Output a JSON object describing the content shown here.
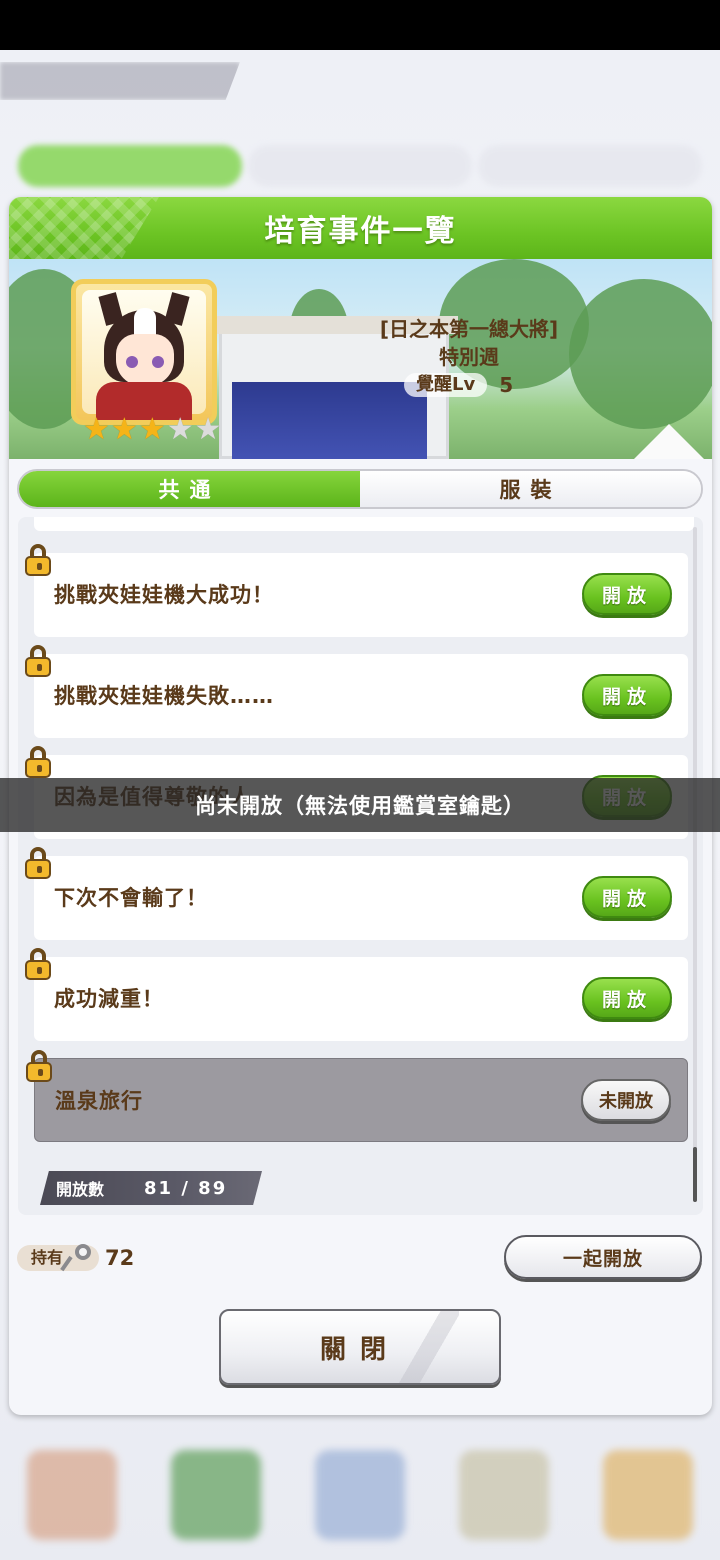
{
  "dialog": {
    "title": "培育事件一覽"
  },
  "character": {
    "scenario_line1": "[日之本第一總大將]",
    "scenario_line2": "特別週",
    "awaken_label": "覺醒Lv",
    "awaken_level": "5",
    "stars": {
      "filled": 3,
      "total": 5
    }
  },
  "tabs": [
    {
      "label": "共通",
      "active": true
    },
    {
      "label": "服裝",
      "active": false
    }
  ],
  "events": [
    {
      "label": "挑戰夾娃娃機大成功！",
      "button": "開放",
      "status": "open"
    },
    {
      "label": "挑戰夾娃娃機失敗……",
      "button": "開放",
      "status": "open"
    },
    {
      "label": "因為是值得尊敬的人",
      "button": "開放",
      "status": "open"
    },
    {
      "label": "下次不會輸了！",
      "button": "開放",
      "status": "open"
    },
    {
      "label": "成功減重！",
      "button": "開放",
      "status": "open"
    },
    {
      "label": "溫泉旅行",
      "button": "未開放",
      "status": "closed"
    }
  ],
  "count": {
    "label": "開放數",
    "value": "81 /  89"
  },
  "footer": {
    "hold_label": "持有",
    "hold_value": "72",
    "open_all_label": "一起開放",
    "close_label": "關閉"
  },
  "toast": {
    "message": "尚未開放（無法使用鑑賞室鑰匙）"
  },
  "colors": {
    "accent_green": "#6cc424",
    "text_brown": "#5a3a1a",
    "star_gold": "#f5b418"
  }
}
